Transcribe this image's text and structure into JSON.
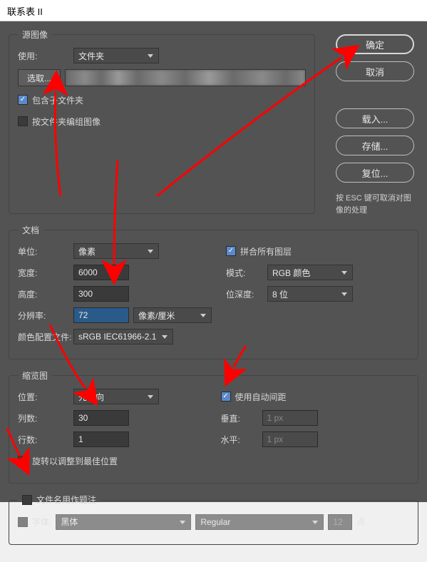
{
  "title": "联系表 II",
  "source": {
    "legend": "源图像",
    "use_label": "使用:",
    "use_value": "文件夹",
    "choose_button": "选取...",
    "include_sub": "包含子文件夹",
    "group_by_folder": "按文件夹编组图像",
    "include_sub_checked": true,
    "group_by_folder_checked": false
  },
  "buttons": {
    "ok": "确定",
    "cancel": "取消",
    "load": "载入...",
    "save": "存储...",
    "reset": "复位..."
  },
  "hint": "按 ESC 键可取消对图像的处理",
  "document": {
    "legend": "文档",
    "unit_label": "单位:",
    "unit_value": "像素",
    "width_label": "宽度:",
    "width_value": "6000",
    "height_label": "高度:",
    "height_value": "300",
    "resolution_label": "分辨率:",
    "resolution_value": "72",
    "resolution_unit": "像素/厘米",
    "profile_label": "颜色配置文件:",
    "profile_value": "sRGB IEC61966-2.1",
    "flatten_label": "拼合所有图层",
    "flatten_checked": true,
    "mode_label": "模式:",
    "mode_value": "RGB 颜色",
    "depth_label": "位深度:",
    "depth_value": "8 位"
  },
  "thumbnail": {
    "legend": "缩览图",
    "placement_label": "位置:",
    "placement_value": "先横向",
    "cols_label": "列数:",
    "cols_value": "30",
    "rows_label": "行数:",
    "rows_value": "1",
    "rotate_label": "旋转以调整到最佳位置",
    "rotate_checked": false,
    "auto_spacing_label": "使用自动间距",
    "auto_spacing_checked": true,
    "vertical_label": "垂直:",
    "vertical_value": "1 px",
    "horizontal_label": "水平:",
    "horizontal_value": "1 px"
  },
  "caption": {
    "legend": "文件名用作题注",
    "legend_checked": false,
    "font_label": "字体:",
    "font_value": "黑体",
    "style_value": "Regular",
    "size_value": "12",
    "size_unit": "点"
  }
}
